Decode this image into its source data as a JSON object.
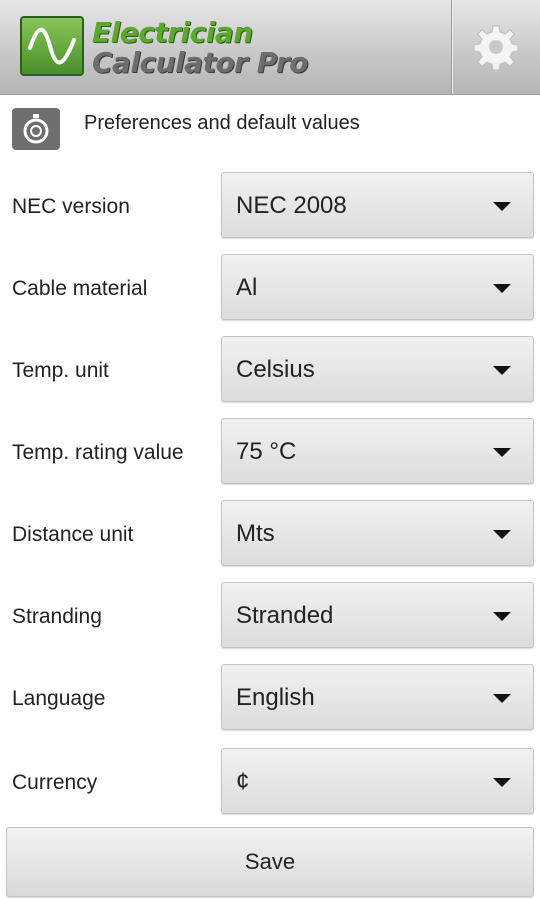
{
  "header": {
    "title_line1": "Electrician",
    "title_line2": "Calculator Pro",
    "logo_icon": "sine-wave-icon",
    "settings_icon": "gear-icon",
    "accent_color": "#5aa82e"
  },
  "section": {
    "icon": "timer-icon",
    "title": "Preferences and default values"
  },
  "preferences": [
    {
      "label": "NEC version",
      "value": "NEC 2008"
    },
    {
      "label": "Cable material",
      "value": "Al"
    },
    {
      "label": "Temp. unit",
      "value": "Celsius"
    },
    {
      "label": "Temp. rating value",
      "value": "75 °C"
    },
    {
      "label": "Distance unit",
      "value": "Mts"
    },
    {
      "label": "Stranding",
      "value": "Stranded"
    },
    {
      "label": "Language",
      "value": "English"
    },
    {
      "label": "Currency",
      "value": "¢"
    }
  ],
  "actions": {
    "save_label": "Save"
  }
}
